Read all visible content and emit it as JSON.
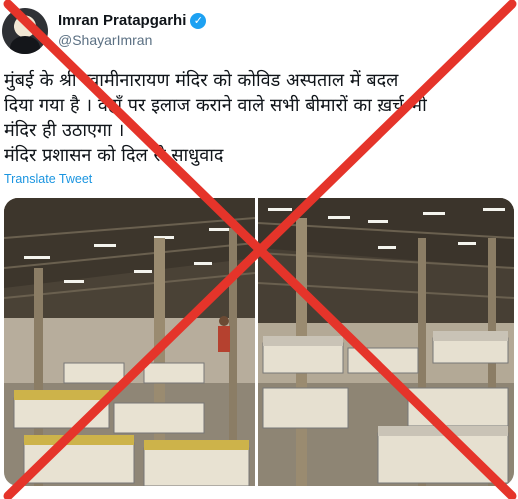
{
  "author": {
    "display_name": "Imran Pratapgarhi",
    "handle": "@ShayarImran",
    "verified": true,
    "avatar_icon": "user-avatar-icon"
  },
  "tweet": {
    "text": "मुंबई के श्री स्वामीनारायण मंदिर को कोविड अस्पताल में बदल\nदिया गया है । वहाँ पर इलाज कराने वाले सभी बीमारों का ख़र्च भी\nमंदिर ही उठाएगा ।\nमंदिर प्रशासन को दिल से साधुवाद",
    "translate_label": "Translate Tweet"
  },
  "overlay": {
    "cross_color": "#e5342a"
  },
  "colors": {
    "accent": "#1da1f2",
    "text": "#0f1419",
    "muted": "#5b7083"
  }
}
